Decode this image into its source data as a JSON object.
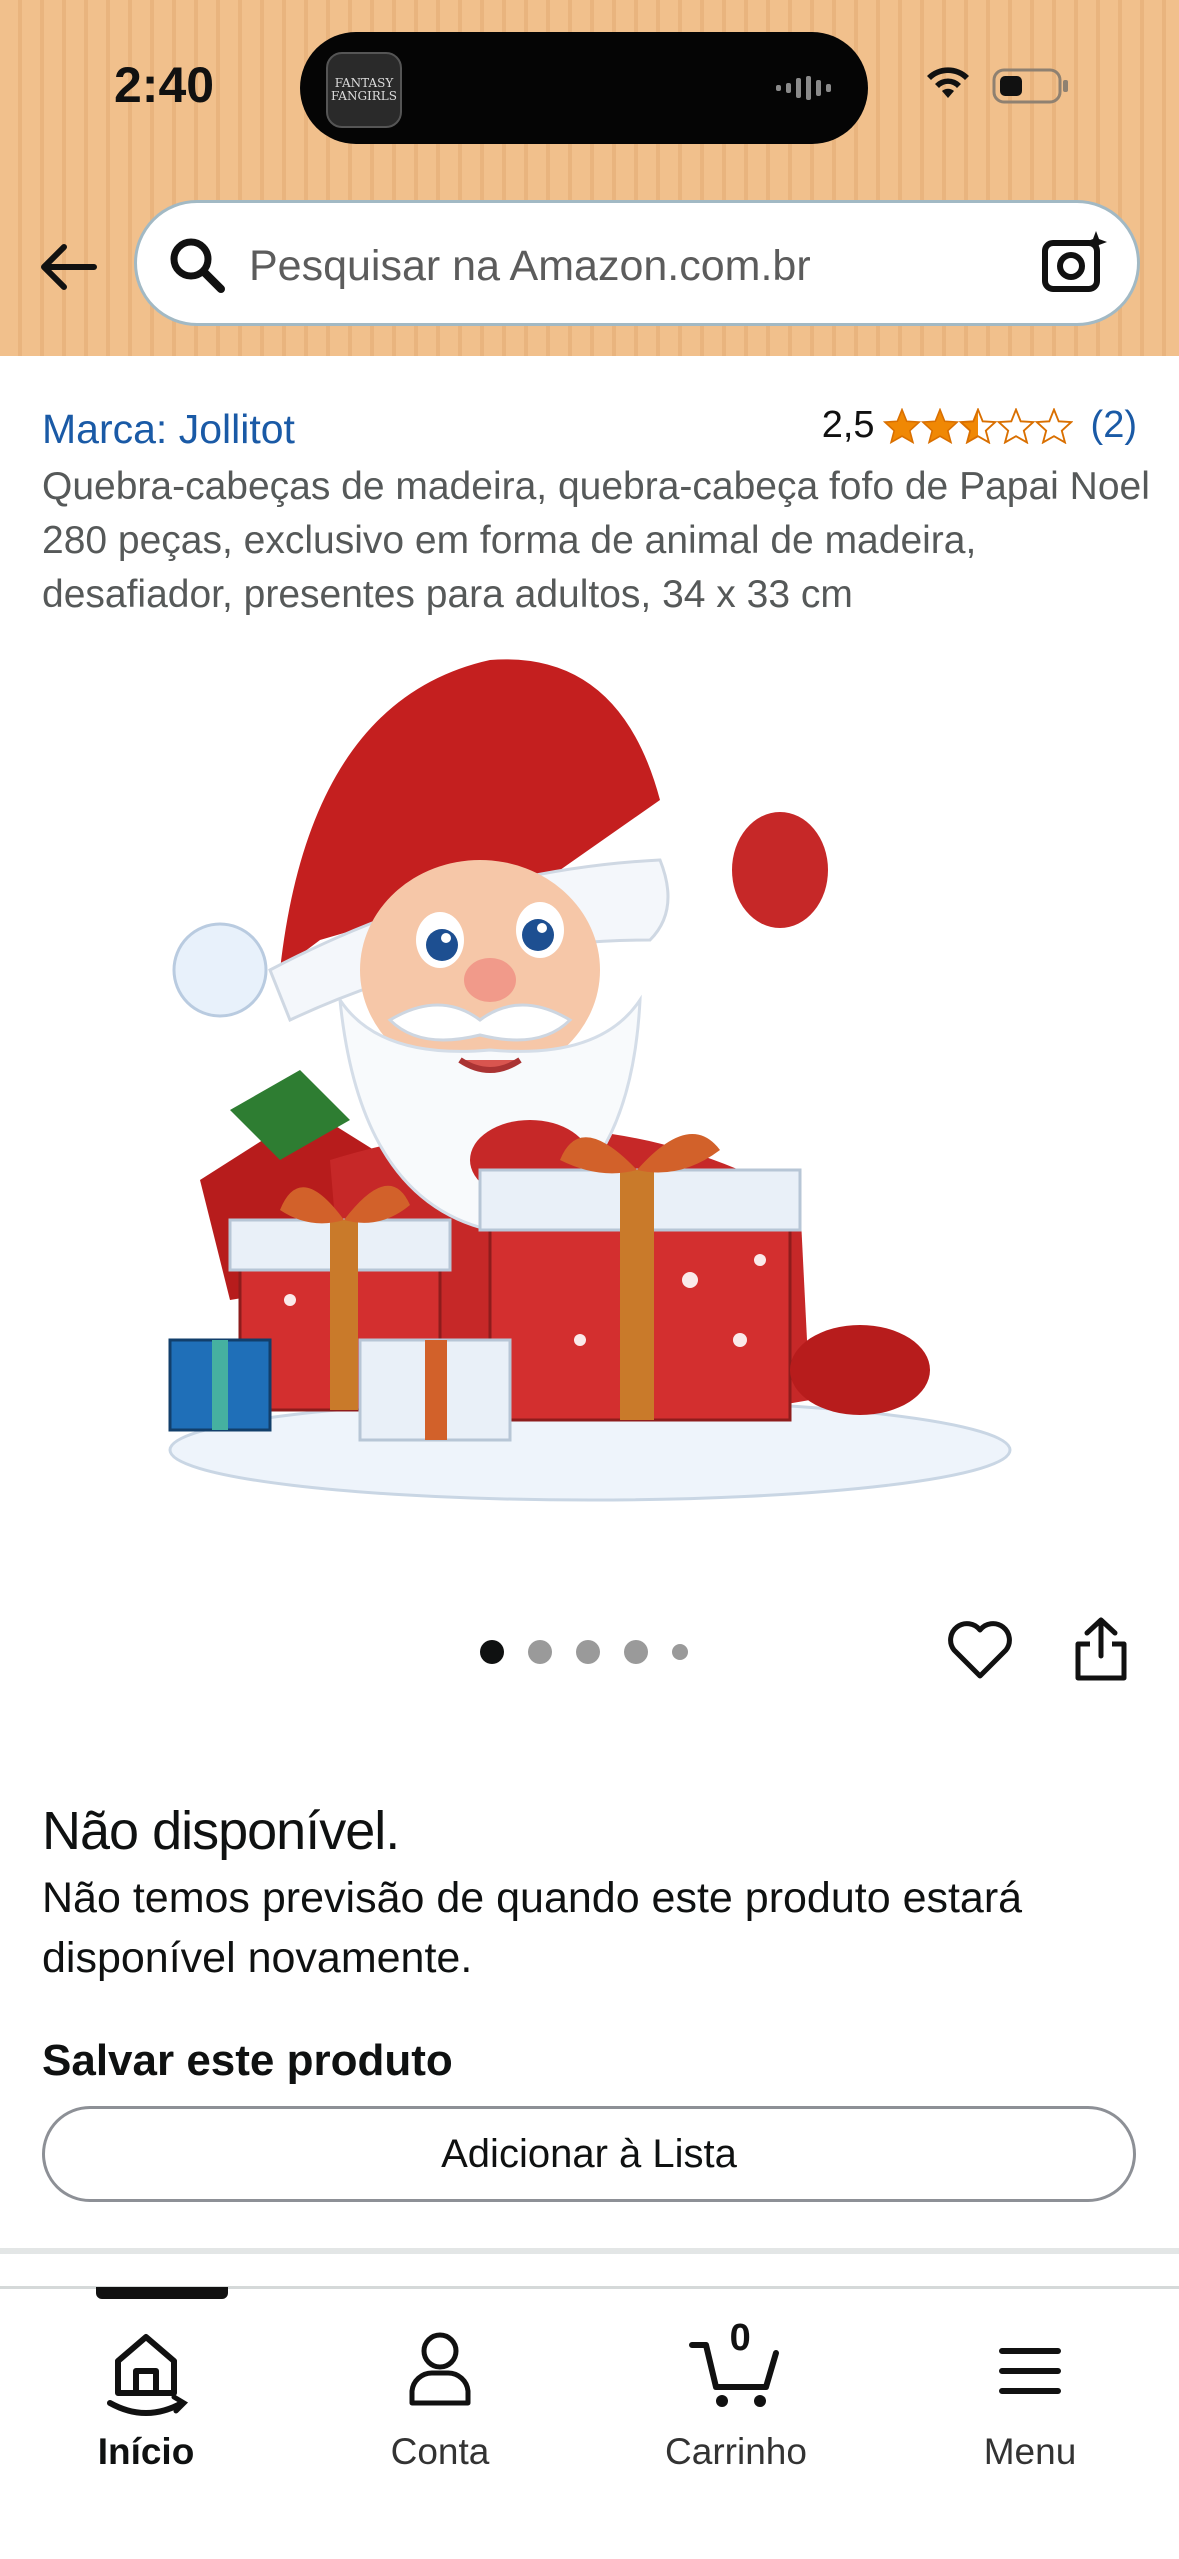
{
  "status_bar": {
    "time": "2:40",
    "island_app_text": "FANTASY FANGIRLS"
  },
  "search": {
    "placeholder": "Pesquisar na Amazon.com.br"
  },
  "product": {
    "brand": "Marca: Jollitot",
    "rating_value": "2,5",
    "rating_stars": 2.5,
    "rating_count": "(2)",
    "title": "Quebra-cabeças de madeira, quebra-cabeça fofo de Papai Noel 280 peças, exclusivo em forma de animal de madeira, desafiador, presentes para adultos, 34 x 33 cm",
    "image_count": 5,
    "current_image": 1
  },
  "availability": {
    "title": "Não disponível.",
    "description": "Não temos previsão de quando este produto estará disponível novamente."
  },
  "save": {
    "label": "Salvar este produto",
    "button": "Adicionar à Lista"
  },
  "bottom_nav": {
    "items": [
      {
        "label": "Início",
        "icon": "home-icon",
        "active": true
      },
      {
        "label": "Conta",
        "icon": "account-icon",
        "active": false
      },
      {
        "label": "Carrinho",
        "icon": "cart-icon",
        "active": false
      },
      {
        "label": "Menu",
        "icon": "menu-icon",
        "active": false
      }
    ],
    "cart_count": "0"
  },
  "colors": {
    "header_bg": "#f1c08c",
    "link": "#1a5aa6",
    "star": "#f08804"
  }
}
